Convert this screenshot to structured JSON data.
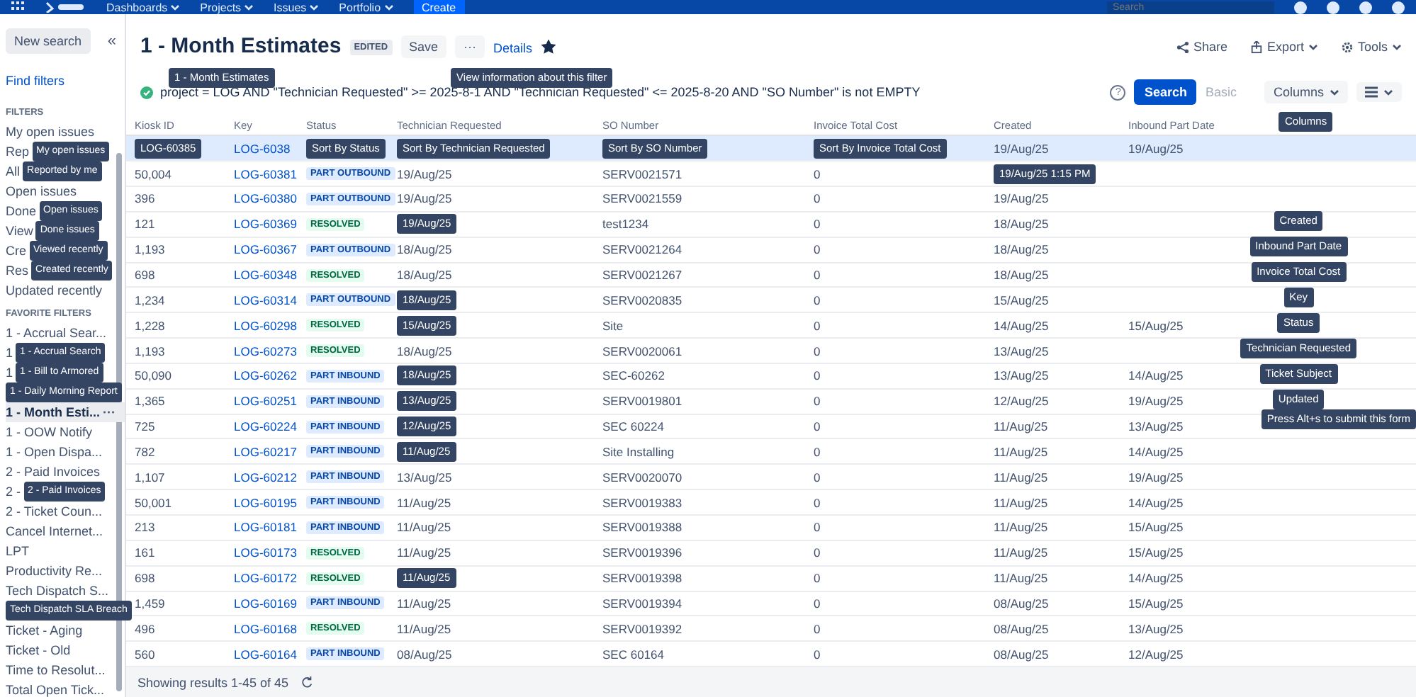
{
  "top_nav": {
    "items": [
      "Dashboards",
      "Projects",
      "Issues",
      "Portfolio"
    ],
    "create": "Create",
    "search": {
      "placeholder": "Search"
    }
  },
  "sidebar": {
    "new_search": "New search",
    "collapse": "«",
    "find_filters": "Find filters",
    "sections": [
      {
        "heading": "FILTERS",
        "items": [
          {
            "label": "My open issues",
            "selected": false
          },
          {
            "label": "Rep",
            "tooltip": "My open issues",
            "selected": false
          },
          {
            "label": "All",
            "tooltip": "Reported by me",
            "selected": false
          },
          {
            "label": "Open issues",
            "selected": false
          },
          {
            "label": "Done",
            "tooltip": "Open issues",
            "selected": false
          },
          {
            "label": "View",
            "tooltip": "Done issues",
            "selected": false
          },
          {
            "label": "Cre",
            "tooltip": "Viewed recently",
            "selected": false
          },
          {
            "label": "Res",
            "tooltip": "Created recently",
            "selected": false
          },
          {
            "label": "Updated recently",
            "selected": false
          }
        ]
      },
      {
        "heading": "FAVORITE FILTERS",
        "items": [
          {
            "label": "1 - Accrual Sear...",
            "selected": false
          },
          {
            "label": "1",
            "tooltip": "1 - Accrual Search",
            "selected": false
          },
          {
            "label": "1",
            "tooltip": "1 - Bill to Armored",
            "selected": false
          },
          {
            "tooltip": "1 - Daily Morning Report",
            "selected": false
          },
          {
            "label": "1 - Month Esti...",
            "more": "···",
            "selected": true
          },
          {
            "label": "1 - OOW Notify",
            "selected": false
          },
          {
            "label": "1 - Open Dispa...",
            "selected": false
          },
          {
            "label": "2 - Paid Invoices",
            "selected": false
          },
          {
            "label": "2 -",
            "tooltip": "2 - Paid Invoices",
            "selected": false
          },
          {
            "label": "2 - Ticket Coun...",
            "selected": false
          },
          {
            "label": "Cancel Internet...",
            "selected": false
          },
          {
            "label": "LPT",
            "selected": false
          },
          {
            "label": "Productivity Re...",
            "selected": false
          },
          {
            "label": "Tech Dispatch S...",
            "selected": false
          },
          {
            "tooltip": "Tech Dispatch SLA Breach",
            "selected": false
          },
          {
            "label": "Ticket - Aging",
            "selected": false
          },
          {
            "label": "Ticket - Old",
            "selected": false
          },
          {
            "label": "Time to Resolut...",
            "selected": false
          },
          {
            "label": "Total Open Tick...",
            "selected": false
          }
        ]
      }
    ]
  },
  "header": {
    "title": "1 - Month Estimates",
    "title_tooltip": "1 - Month Estimates",
    "edited": "EDITED",
    "save": "Save",
    "more": "···",
    "details": "Details",
    "details_tooltip": "View information about this filter",
    "starred": true,
    "actions": [
      {
        "label": "Share",
        "kind": "share"
      },
      {
        "label": "Export",
        "kind": "export"
      },
      {
        "label": "Tools",
        "kind": "tools"
      }
    ]
  },
  "query": {
    "valid": true,
    "jql": "project = LOG AND \"Technician Requested\" >= 2025-8-1 AND \"Technician Requested\" <= 2025-8-20 AND \"SO Number\" is not EMPTY",
    "help": "?",
    "search": "Search",
    "basic": "Basic",
    "columns": "Columns",
    "columns_tooltip": "Columns"
  },
  "table": {
    "columns": [
      {
        "label": "Kiosk ID",
        "kind": "text"
      },
      {
        "label": "Key",
        "kind": "link"
      },
      {
        "label": "Status",
        "kind": "status"
      },
      {
        "label": "Technician Requested",
        "kind": "text"
      },
      {
        "label": "SO Number",
        "kind": "text"
      },
      {
        "label": "Invoice Total Cost",
        "kind": "text"
      },
      {
        "label": "Created",
        "kind": "text"
      },
      {
        "label": "Inbound Part Date",
        "kind": "text"
      }
    ],
    "rows": [
      {
        "selected": true,
        "cells": [
          {
            "tooltip": "LOG-60385"
          },
          "LOG-6038",
          {
            "tooltip": "Sort By Status"
          },
          {
            "tooltip": "Sort By Technician Requested"
          },
          {
            "tooltip": "Sort By SO Number"
          },
          {
            "tooltip": "Sort By Invoice Total Cost"
          },
          "19/Aug/25",
          "19/Aug/25"
        ]
      },
      {
        "selected": false,
        "cells": [
          "50,004",
          "LOG-60381",
          {
            "text": "PART OUTBOUND",
            "kind": "progress"
          },
          "19/Aug/25",
          "SERV0021571",
          "0",
          {
            "tooltip": "19/Aug/25 1:15 PM"
          },
          ""
        ]
      },
      {
        "selected": false,
        "cells": [
          "396",
          "LOG-60380",
          {
            "text": "PART OUTBOUND",
            "kind": "progress"
          },
          "19/Aug/25",
          "SERV0021559",
          "0",
          "19/Aug/25",
          ""
        ]
      },
      {
        "selected": false,
        "cells": [
          "121",
          "LOG-60369",
          {
            "text": "RESOLVED",
            "kind": "done"
          },
          {
            "tooltip": "19/Aug/25"
          },
          "test1234",
          "0",
          "18/Aug/25",
          ""
        ]
      },
      {
        "selected": false,
        "cells": [
          "1,193",
          "LOG-60367",
          {
            "text": "PART OUTBOUND",
            "kind": "progress"
          },
          "18/Aug/25",
          "SERV0021264",
          "0",
          "18/Aug/25",
          ""
        ]
      },
      {
        "selected": false,
        "cells": [
          "698",
          "LOG-60348",
          {
            "text": "RESOLVED",
            "kind": "done"
          },
          "18/Aug/25",
          "SERV0021267",
          "0",
          "18/Aug/25",
          ""
        ]
      },
      {
        "selected": false,
        "cells": [
          "1,234",
          "LOG-60314",
          {
            "text": "PART OUTBOUND",
            "kind": "progress"
          },
          {
            "tooltip": "18/Aug/25"
          },
          "SERV0020835",
          "0",
          "15/Aug/25",
          ""
        ]
      },
      {
        "selected": false,
        "cells": [
          "1,228",
          "LOG-60298",
          {
            "text": "RESOLVED",
            "kind": "done"
          },
          {
            "tooltip": "15/Aug/25"
          },
          "Site",
          "0",
          "14/Aug/25",
          "15/Aug/25"
        ]
      },
      {
        "selected": false,
        "cells": [
          "1,193",
          "LOG-60273",
          {
            "text": "RESOLVED",
            "kind": "done"
          },
          "18/Aug/25",
          "SERV0020061",
          "0",
          "13/Aug/25",
          ""
        ]
      },
      {
        "selected": false,
        "cells": [
          "50,090",
          "LOG-60262",
          {
            "text": "PART INBOUND",
            "kind": "progress"
          },
          {
            "tooltip": "18/Aug/25"
          },
          "SEC-60262",
          "0",
          "13/Aug/25",
          "14/Aug/25"
        ]
      },
      {
        "selected": false,
        "cells": [
          "1,365",
          "LOG-60251",
          {
            "text": "PART INBOUND",
            "kind": "progress"
          },
          {
            "tooltip": "13/Aug/25"
          },
          "SERV0019801",
          "0",
          "12/Aug/25",
          "19/Aug/25"
        ]
      },
      {
        "selected": false,
        "cells": [
          "725",
          "LOG-60224",
          {
            "text": "PART INBOUND",
            "kind": "progress"
          },
          {
            "tooltip": "12/Aug/25"
          },
          "SEC 60224",
          "0",
          "11/Aug/25",
          "13/Aug/25"
        ]
      },
      {
        "selected": false,
        "cells": [
          "782",
          "LOG-60217",
          {
            "text": "PART INBOUND",
            "kind": "progress"
          },
          {
            "tooltip": "11/Aug/25"
          },
          "Site Installing",
          "0",
          "11/Aug/25",
          "14/Aug/25"
        ]
      },
      {
        "selected": false,
        "cells": [
          "1,107",
          "LOG-60212",
          {
            "text": "PART INBOUND",
            "kind": "progress"
          },
          "13/Aug/25",
          "SERV0020070",
          "0",
          "11/Aug/25",
          "19/Aug/25"
        ]
      },
      {
        "selected": false,
        "cells": [
          "50,001",
          "LOG-60195",
          {
            "text": "PART INBOUND",
            "kind": "progress"
          },
          "11/Aug/25",
          "SERV0019383",
          "0",
          "11/Aug/25",
          "14/Aug/25"
        ]
      },
      {
        "selected": false,
        "cells": [
          "213",
          "LOG-60181",
          {
            "text": "PART INBOUND",
            "kind": "progress"
          },
          "11/Aug/25",
          "SERV0019388",
          "0",
          "11/Aug/25",
          "15/Aug/25"
        ]
      },
      {
        "selected": false,
        "cells": [
          "161",
          "LOG-60173",
          {
            "text": "RESOLVED",
            "kind": "done"
          },
          "11/Aug/25",
          "SERV0019396",
          "0",
          "11/Aug/25",
          "15/Aug/25"
        ]
      },
      {
        "selected": false,
        "cells": [
          "698",
          "LOG-60172",
          {
            "text": "RESOLVED",
            "kind": "done"
          },
          {
            "tooltip": "11/Aug/25"
          },
          "SERV0019398",
          "0",
          "11/Aug/25",
          "14/Aug/25"
        ]
      },
      {
        "selected": false,
        "cells": [
          "1,459",
          "LOG-60169",
          {
            "text": "PART INBOUND",
            "kind": "progress"
          },
          "11/Aug/25",
          "SERV0019394",
          "0",
          "08/Aug/25",
          "15/Aug/25"
        ]
      },
      {
        "selected": false,
        "cells": [
          "496",
          "LOG-60168",
          {
            "text": "RESOLVED",
            "kind": "done"
          },
          "11/Aug/25",
          "SERV0019392",
          "0",
          "08/Aug/25",
          "13/Aug/25"
        ]
      },
      {
        "selected": false,
        "cells": [
          "560",
          "LOG-60164",
          {
            "text": "PART INBOUND",
            "kind": "progress"
          },
          "08/Aug/25",
          "SEC 60164",
          "0",
          "08/Aug/25",
          "12/Aug/25"
        ]
      }
    ]
  },
  "column_tooltips": [
    "Created",
    "Inbound Part Date",
    "Invoice Total Cost",
    "Key",
    "Status",
    "Technician Requested",
    "Ticket Subject",
    "Updated"
  ],
  "form_tooltip": "Press Alt+s to submit this form",
  "footer": {
    "summary": "Showing results 1-45 of 45"
  }
}
